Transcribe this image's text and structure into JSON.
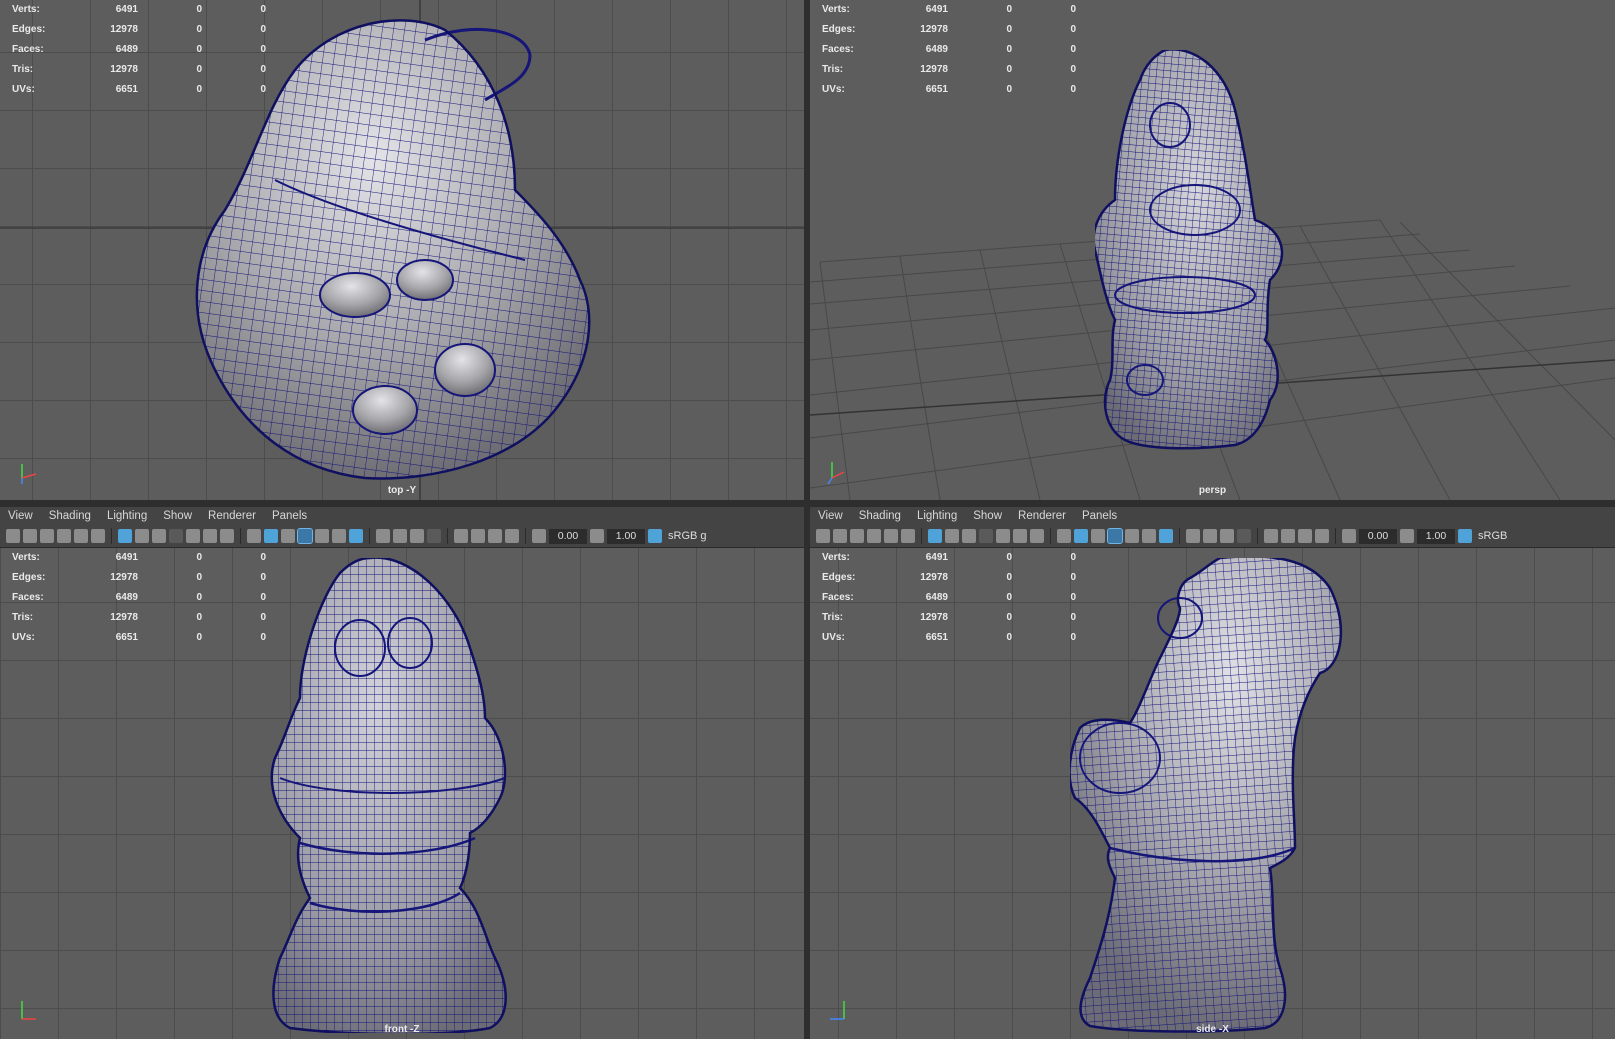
{
  "stats": [
    {
      "label": "Verts:",
      "value": "6491",
      "a": "0",
      "b": "0"
    },
    {
      "label": "Edges:",
      "value": "12978",
      "a": "0",
      "b": "0"
    },
    {
      "label": "Faces:",
      "value": "6489",
      "a": "0",
      "b": "0"
    },
    {
      "label": "Tris:",
      "value": "12978",
      "a": "0",
      "b": "0"
    },
    {
      "label": "UVs:",
      "value": "6651",
      "a": "0",
      "b": "0"
    }
  ],
  "viewports": {
    "top_left": {
      "camera": "top -Y"
    },
    "top_right": {
      "camera": "persp"
    },
    "bottom_left": {
      "camera": "front -Z"
    },
    "bottom_right": {
      "camera": "side -X"
    }
  },
  "menu": [
    "View",
    "Shading",
    "Lighting",
    "Show",
    "Renderer",
    "Panels"
  ],
  "toolbar": {
    "exposure": "0.00",
    "gamma": "1.00",
    "colorspace": "sRGB g",
    "colorspace_right": "sRGB"
  },
  "colors": {
    "viewport_bg": "#5d5d5d",
    "wire": "#1a1a8c",
    "mesh": "#a8a8ac",
    "accent": "#4fa3d8"
  }
}
